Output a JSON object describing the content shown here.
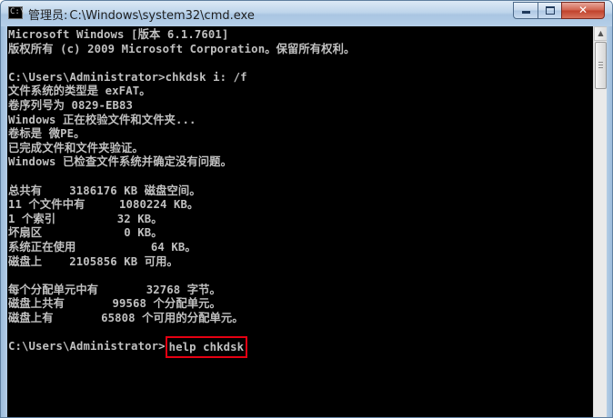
{
  "window": {
    "title_prefix": "管理员:",
    "title_path": "C:\\Windows\\system32\\cmd.exe",
    "icon_glyph": "C:\\",
    "controls": {
      "minimize_icon": "minimize-icon",
      "maximize_icon": "maximize-icon",
      "close_icon": "close-icon",
      "close_glyph": "✕"
    }
  },
  "console": {
    "lines": [
      "Microsoft Windows [版本 6.1.7601]",
      "版权所有 (c) 2009 Microsoft Corporation。保留所有权利。",
      "",
      "C:\\Users\\Administrator>chkdsk i: /f",
      "文件系统的类型是 exFAT。",
      "卷序列号为 0829-EB83",
      "Windows 正在校验文件和文件夹...",
      "卷标是 微PE。",
      "已完成文件和文件夹验证。",
      "Windows 已检查文件系统并确定没有问题。",
      "",
      "总共有    3186176 KB 磁盘空间。",
      "11 个文件中有     1080224 KB。",
      "1 个索引         32 KB。",
      "坏扇区            0 KB。",
      "系统正在使用           64 KB。",
      "磁盘上    2105856 KB 可用。",
      "",
      "每个分配单元中有       32768 字节。",
      "磁盘上共有       99568 个分配单元。",
      "磁盘上有       65808 个可用的分配单元。",
      ""
    ],
    "prompt": "C:\\Users\\Administrator>",
    "command": "help chkdsk"
  },
  "colors": {
    "console_bg": "#000000",
    "console_text": "#c0c0c0",
    "highlight_border": "#e60012",
    "close_button": "#c0412b"
  },
  "scrollbar": {
    "up_arrow_icon": "scroll-up-arrow-icon",
    "up_glyph": "▲"
  }
}
